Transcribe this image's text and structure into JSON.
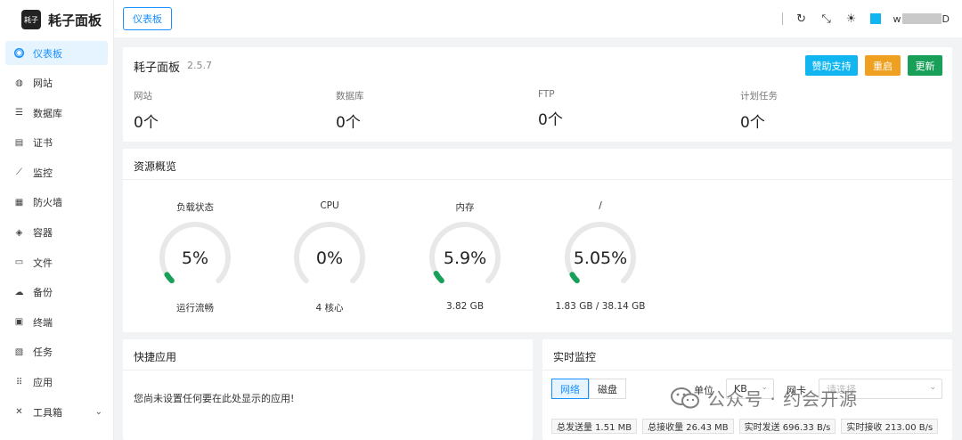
{
  "brand": {
    "logo_text": "耗子",
    "title": "耗子面板"
  },
  "sidebar": {
    "items": [
      {
        "label": "仪表板",
        "icon": "dashboard-icon",
        "glyph": "◉",
        "active": true
      },
      {
        "label": "网站",
        "icon": "globe-icon",
        "glyph": "◍"
      },
      {
        "label": "数据库",
        "icon": "database-icon",
        "glyph": "☰"
      },
      {
        "label": "证书",
        "icon": "certificate-icon",
        "glyph": "▤"
      },
      {
        "label": "监控",
        "icon": "monitor-chart-icon",
        "glyph": "⟋"
      },
      {
        "label": "防火墙",
        "icon": "firewall-icon",
        "glyph": "▦"
      },
      {
        "label": "容器",
        "icon": "container-icon",
        "glyph": "◈"
      },
      {
        "label": "文件",
        "icon": "folder-icon",
        "glyph": "▭"
      },
      {
        "label": "备份",
        "icon": "backup-cloud-icon",
        "glyph": "☁"
      },
      {
        "label": "终端",
        "icon": "terminal-icon",
        "glyph": "▣"
      },
      {
        "label": "任务",
        "icon": "task-icon",
        "glyph": "▧"
      },
      {
        "label": "应用",
        "icon": "apps-grid-icon",
        "glyph": "⠿"
      },
      {
        "label": "工具箱",
        "icon": "toolbox-icon",
        "glyph": "✕",
        "expandable": true
      }
    ]
  },
  "topbar": {
    "tab_label": "仪表板",
    "icons": [
      "refresh-icon",
      "fullscreen-icon",
      "theme-sun-icon"
    ],
    "user": {
      "prefix": "w",
      "suffix": "D",
      "avatar_color": "#11b6f0"
    }
  },
  "summary": {
    "title": "耗子面板",
    "version": "2.5.7",
    "buttons": {
      "sponsor": "赞助支持",
      "restart": "重启",
      "update": "更新"
    },
    "stats": [
      {
        "label": "网站",
        "value": "0个"
      },
      {
        "label": "数据库",
        "value": "0个"
      },
      {
        "label": "FTP",
        "value": "0个"
      },
      {
        "label": "计划任务",
        "value": "0个"
      }
    ]
  },
  "resources": {
    "title": "资源概览",
    "gauges": [
      {
        "label": "负载状态",
        "value_text": "5%",
        "percent": 5,
        "sub": "运行流畅"
      },
      {
        "label": "CPU",
        "value_text": "0%",
        "percent": 0,
        "sub": "4 核心"
      },
      {
        "label": "内存",
        "value_text": "5.9%",
        "percent": 5.9,
        "sub": "3.82 GB"
      },
      {
        "label": "/",
        "value_text": "5.05%",
        "percent": 5.05,
        "sub": "1.83 GB / 38.14 GB"
      }
    ],
    "colors": {
      "track": "#e8e8e8",
      "fill": "#18a058"
    }
  },
  "quick_apps": {
    "title": "快捷应用",
    "empty_text": "您尚未设置任何要在此处显示的应用!"
  },
  "monitor": {
    "title": "实时监控",
    "tabs": [
      {
        "label": "网络",
        "active": true
      },
      {
        "label": "磁盘"
      }
    ],
    "unit_label": "单位",
    "unit_value": "KB",
    "nic_label": "网卡",
    "nic_placeholder": "请选择",
    "chips": [
      "总发送量 1.51 MB",
      "总接收量 26.43 MB",
      "实时发送 696.33 B/s",
      "实时接收 213.00 B/s"
    ]
  },
  "watermark": {
    "text": "公众号 · 约会开源"
  }
}
